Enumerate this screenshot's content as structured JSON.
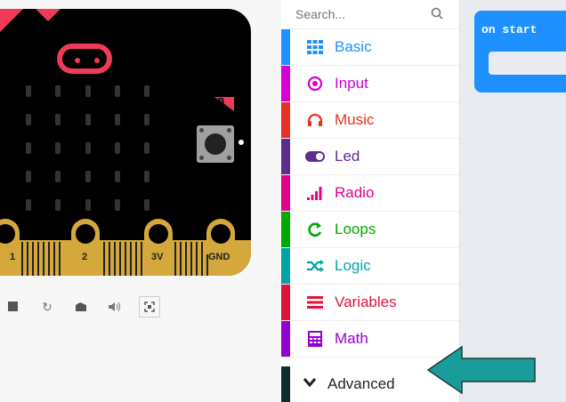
{
  "simulator": {
    "pins": [
      {
        "label": "1"
      },
      {
        "label": "2"
      },
      {
        "label": "3V"
      },
      {
        "label": "GND"
      }
    ],
    "button_b_label": "B",
    "controls": [
      "stop-icon",
      "restart-icon",
      "debug-icon",
      "mute-icon",
      "fullscreen-icon"
    ]
  },
  "toolbox": {
    "search": {
      "placeholder": "Search..."
    },
    "categories": [
      {
        "label": "Basic",
        "color": "#1e90ff",
        "icon": "grid-icon"
      },
      {
        "label": "Input",
        "color": "#d400d4",
        "icon": "target-icon"
      },
      {
        "label": "Music",
        "color": "#e63022",
        "icon": "headphones-icon"
      },
      {
        "label": "Led",
        "color": "#5c2d91",
        "icon": "toggle-icon"
      },
      {
        "label": "Radio",
        "color": "#e3008c",
        "icon": "signal-icon"
      },
      {
        "label": "Loops",
        "color": "#00aa00",
        "icon": "loop-icon"
      },
      {
        "label": "Logic",
        "color": "#00a4a6",
        "icon": "shuffle-icon"
      },
      {
        "label": "Variables",
        "color": "#dc143c",
        "icon": "list-icon"
      },
      {
        "label": "Math",
        "color": "#9400d3",
        "icon": "calculator-icon"
      }
    ],
    "advanced": {
      "label": "Advanced",
      "color": "#0f2d2e"
    }
  },
  "workspace": {
    "on_start_label": "on start",
    "on_start_color": "#1e90ff"
  },
  "annotation": {
    "arrow_color": "#1a9c9a"
  }
}
